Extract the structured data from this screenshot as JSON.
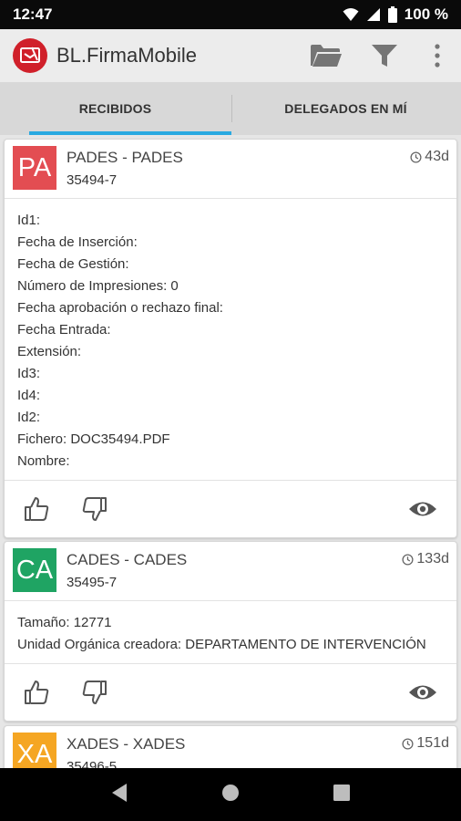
{
  "status_bar": {
    "time": "12:47",
    "battery": "100 %"
  },
  "app_bar": {
    "title": "BL.FirmaMobile",
    "actions": [
      "folder-icon",
      "filter-icon",
      "more-vert-icon"
    ]
  },
  "tabs": [
    {
      "label": "RECIBIDOS",
      "selected": true
    },
    {
      "label": "DELEGADOS EN MÍ",
      "selected": false
    }
  ],
  "colors": {
    "accent": "#29a9e1",
    "brand_red": "#d0202a",
    "pades": "#e34d52",
    "cades": "#1fa463",
    "xades": "#f5a623"
  },
  "cards": [
    {
      "badge": "PA",
      "type": "PADES - PADES",
      "code": "35494-7",
      "age": "43d",
      "details": [
        "Id1:",
        "Fecha de Inserción:",
        "Fecha de Gestión:",
        "Número de Impresiones: 0",
        "Fecha aprobación o rechazo final:",
        "Fecha Entrada:",
        "Extensión:",
        "Id3:",
        "Id4:",
        "Id2:",
        "Fichero: DOC35494.PDF",
        "Nombre:"
      ]
    },
    {
      "badge": "CA",
      "type": "CADES - CADES",
      "code": "35495-7",
      "age": "133d",
      "details": [
        "Tamaño: 12771",
        "Unidad Orgánica creadora: DEPARTAMENTO DE INTERVENCIÓN"
      ]
    },
    {
      "badge": "XA",
      "type": "XADES - XADES",
      "code": "35496-5",
      "age": "151d",
      "details": []
    }
  ],
  "nav_bar": [
    "back-icon",
    "home-icon",
    "recents-icon"
  ]
}
